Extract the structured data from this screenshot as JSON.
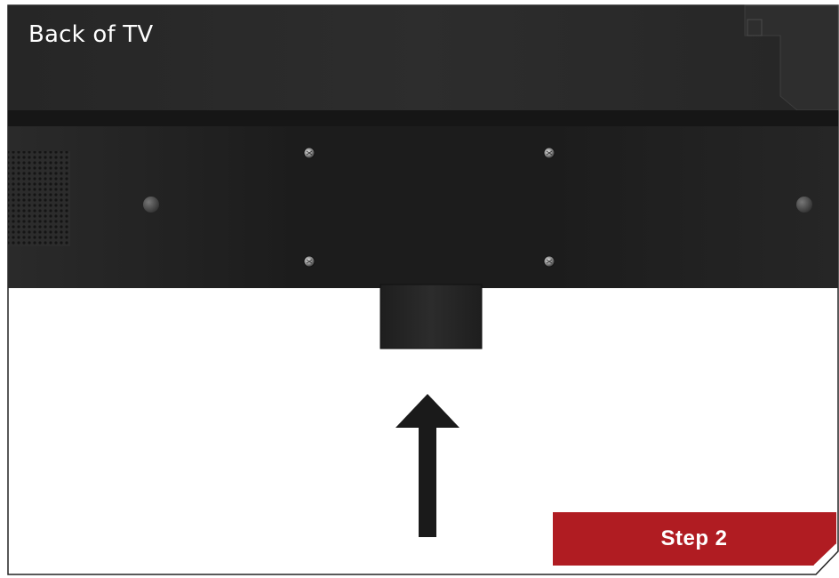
{
  "diagram": {
    "title": "Back of TV",
    "step_label": "Step 2"
  },
  "colors": {
    "panel": "#2a2a2a",
    "mount_plate": "#1b1b1b",
    "stripe": "#161616",
    "step_badge": "#b01c22",
    "arrow": "#1a1a1a",
    "outline": "#000000"
  },
  "icons": [
    "screw-icon",
    "up-arrow-icon",
    "speaker-grille",
    "stand-neck"
  ]
}
